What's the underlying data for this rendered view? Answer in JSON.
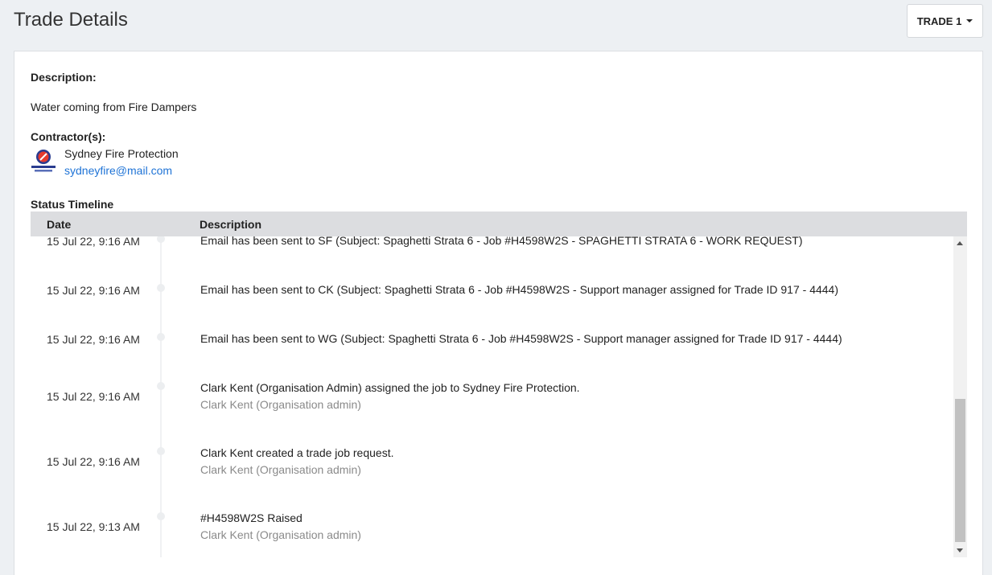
{
  "header": {
    "title": "Trade Details",
    "trade_selector": "TRADE 1"
  },
  "details": {
    "description_label": "Description:",
    "description_value": "Water coming from Fire Dampers",
    "contractors_label": "Contractor(s):",
    "contractor": {
      "name": "Sydney Fire Protection",
      "email": "sydneyfire@mail.com",
      "avatar_icon": "fire-protection-logo-icon"
    }
  },
  "timeline": {
    "label": "Status Timeline",
    "columns": {
      "date": "Date",
      "description": "Description"
    },
    "rows": [
      {
        "date": "15 Jul 22, 9:16 AM",
        "text": "Email has been sent to SF (Subject: Spaghetti Strata 6 - Job #H4598W2S - SPAGHETTI STRATA 6 - WORK REQUEST)",
        "sub": ""
      },
      {
        "date": "15 Jul 22, 9:16 AM",
        "text": "Email has been sent to CK (Subject: Spaghetti Strata 6 - Job #H4598W2S - Support manager assigned for Trade ID 917 - 4444)",
        "sub": ""
      },
      {
        "date": "15 Jul 22, 9:16 AM",
        "text": "Email has been sent to WG (Subject: Spaghetti Strata 6 - Job #H4598W2S - Support manager assigned for Trade ID 917 - 4444)",
        "sub": ""
      },
      {
        "date": "15 Jul 22, 9:16 AM",
        "text": "Clark Kent (Organisation Admin) assigned the job to Sydney Fire Protection.",
        "sub": "Clark Kent (Organisation admin)"
      },
      {
        "date": "15 Jul 22, 9:16 AM",
        "text": "Clark Kent created a trade job request.",
        "sub": "Clark Kent (Organisation admin)"
      },
      {
        "date": "15 Jul 22, 9:13 AM",
        "text": "#H4598W2S Raised",
        "sub": "Clark Kent (Organisation admin)"
      }
    ]
  },
  "colors": {
    "background": "#edf0f3",
    "link": "#1e73d6",
    "table_header": "#dcdde0",
    "muted_text": "#8a8a8a"
  }
}
